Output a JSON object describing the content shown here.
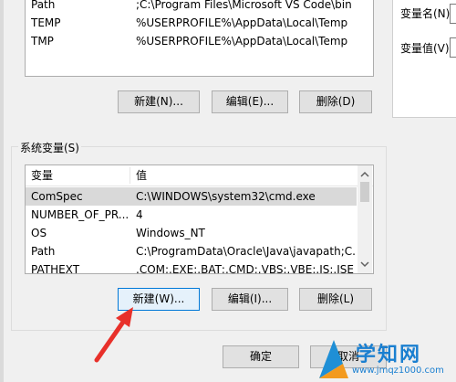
{
  "user_vars": {
    "rows": [
      {
        "name": "Path",
        "value": ";C:\\Program Files\\Microsoft VS Code\\bin"
      },
      {
        "name": "TEMP",
        "value": "%USERPROFILE%\\AppData\\Local\\Temp"
      },
      {
        "name": "TMP",
        "value": "%USERPROFILE%\\AppData\\Local\\Temp"
      }
    ],
    "buttons": {
      "new": "新建(N)...",
      "edit": "编辑(E)...",
      "delete": "删除(D)"
    }
  },
  "system_vars": {
    "title": "系统变量(S)",
    "col_name": "变量",
    "col_value": "值",
    "rows": [
      {
        "name": "ComSpec",
        "value": "C:\\WINDOWS\\system32\\cmd.exe"
      },
      {
        "name": "NUMBER_OF_PR...",
        "value": "4"
      },
      {
        "name": "OS",
        "value": "Windows_NT"
      },
      {
        "name": "Path",
        "value": "C:\\ProgramData\\Oracle\\Java\\javapath;C..."
      },
      {
        "name": "PATHEXT",
        "value": ".COM;.EXE;.BAT;.CMD;.VBS;.VBE;.JS;.JSE;..."
      }
    ],
    "buttons": {
      "new": "新建(W)...",
      "edit": "编辑(I)...",
      "delete": "删除(L)"
    }
  },
  "footer": {
    "ok": "确定",
    "cancel": "取消"
  },
  "side_dialog": {
    "var_name_label": "变量名(N):",
    "var_value_label": "变量值(V):"
  },
  "watermark": {
    "brand": "学知网",
    "url": "www.jmqz1000.com"
  },
  "colors": {
    "arrow": "#e8302a",
    "focus": "#0078d7",
    "selected_row": "#d9d9d9"
  }
}
